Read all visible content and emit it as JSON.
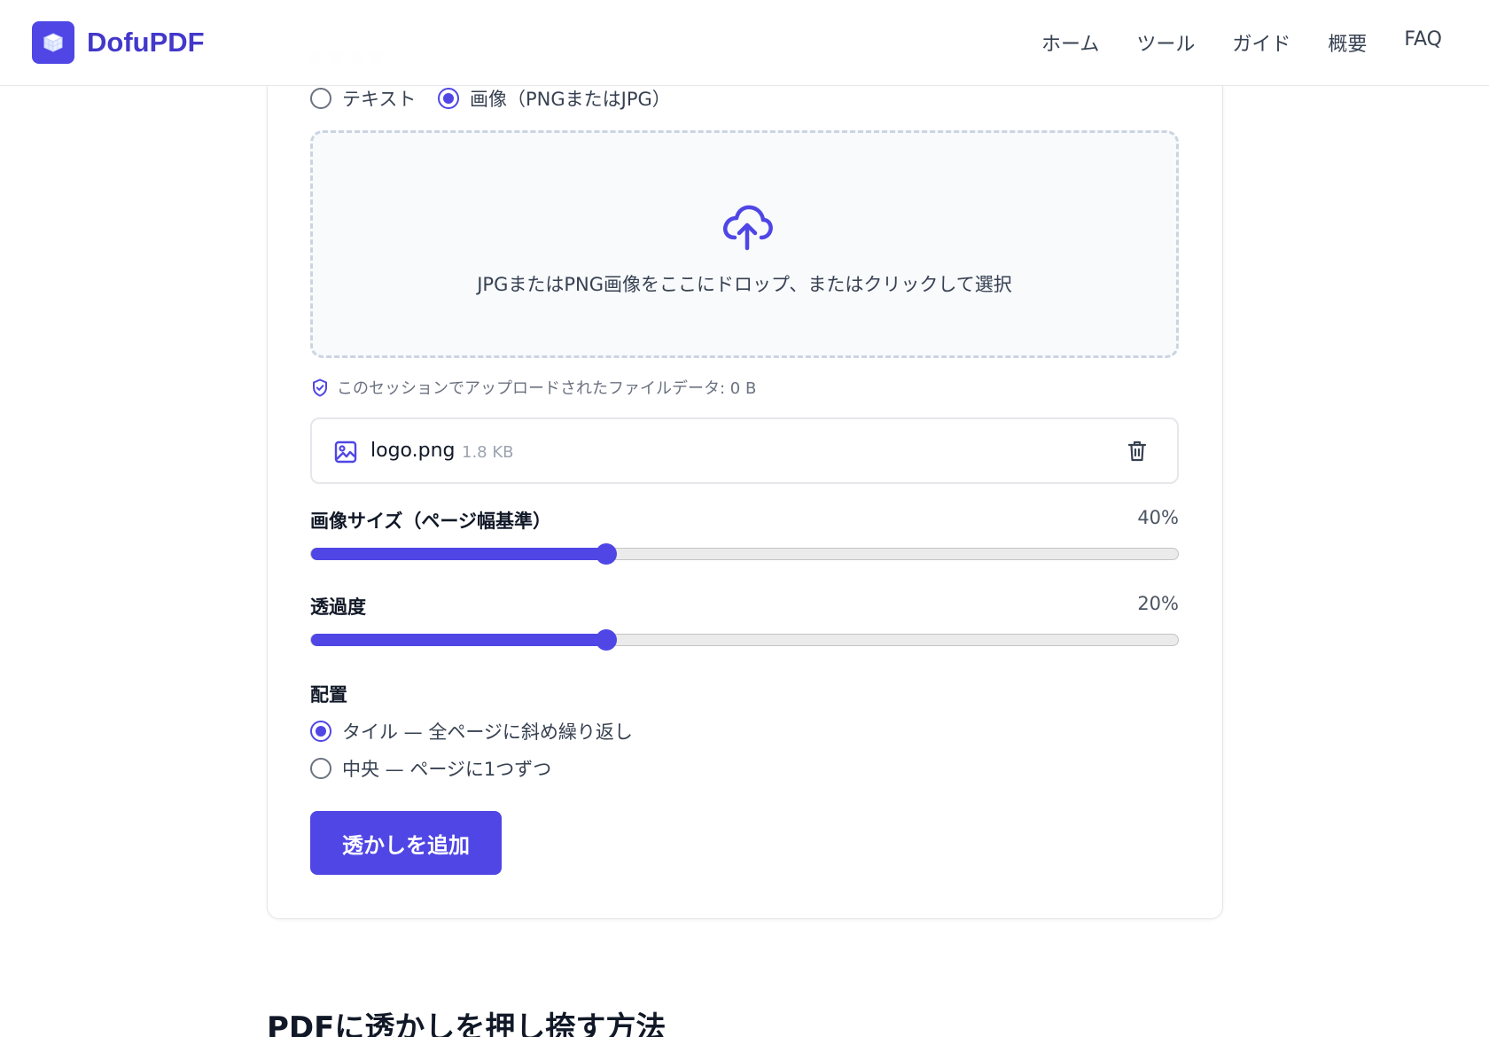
{
  "header": {
    "brand": "DofuPDF",
    "nav": [
      "ホーム",
      "ツール",
      "ガイド",
      "概要",
      "FAQ"
    ]
  },
  "watermark_type": {
    "options": [
      {
        "label": "テキスト",
        "selected": false
      },
      {
        "label": "画像（PNGまたはJPG）",
        "selected": true
      }
    ]
  },
  "dropzone": {
    "text": "JPGまたはPNG画像をここにドロップ、またはクリックして選択",
    "icon": "cloud-upload-icon"
  },
  "privacy": {
    "text": "このセッションでアップロードされたファイルデータ: 0 B",
    "icon": "shield-check-icon"
  },
  "file": {
    "name": "logo.png",
    "size": "1.8 KB"
  },
  "image_size": {
    "label": "画像サイズ（ページ幅基準）",
    "value": "40%",
    "fraction": 0.34
  },
  "opacity": {
    "label": "透過度",
    "value": "20%",
    "fraction": 0.34
  },
  "placement": {
    "label": "配置",
    "options": [
      {
        "label": "タイル — 全ページに斜め繰り返し",
        "selected": true
      },
      {
        "label": "中央 — ページに1つずつ",
        "selected": false
      }
    ]
  },
  "submit": {
    "label": "透かしを追加"
  },
  "section": {
    "title": "PDFに透かしを押し捺す方法"
  },
  "colors": {
    "accent": "#4f46e5",
    "brand_text": "#4338ca"
  }
}
